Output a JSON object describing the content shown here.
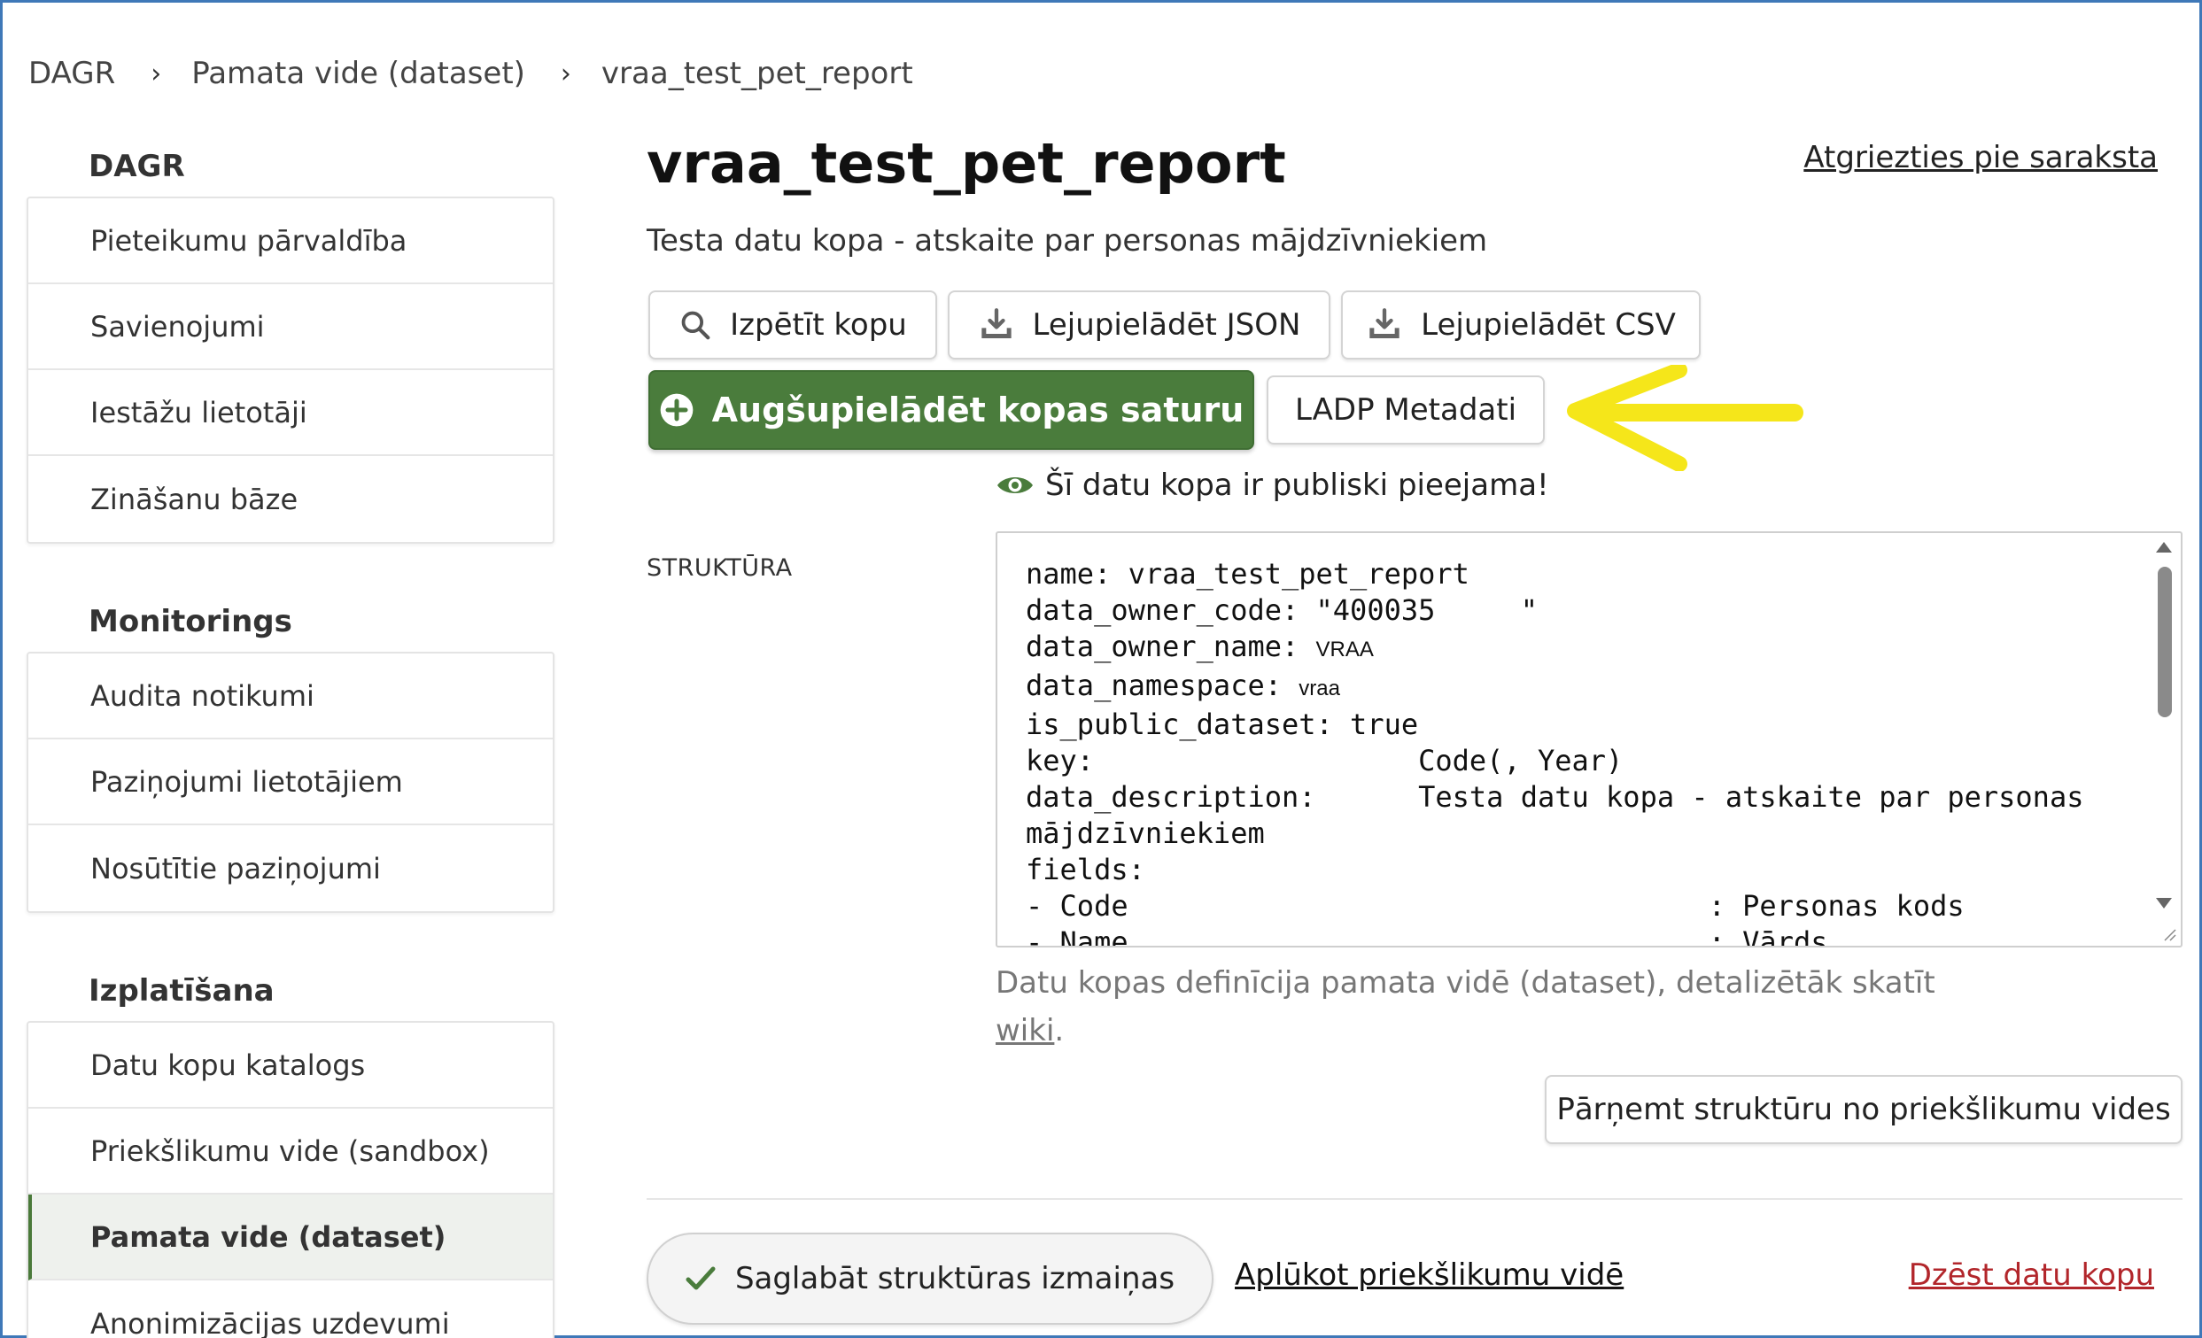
{
  "breadcrumb": {
    "items": [
      "DAGR",
      "Pamata vide (dataset)",
      "vraa_test_pet_report"
    ],
    "separator": "›"
  },
  "sidebar": {
    "sections": [
      {
        "title": "DAGR",
        "items": [
          "Pieteikumu pārvaldība",
          "Savienojumi",
          "Iestāžu lietotāji",
          "Zināšanu bāze"
        ]
      },
      {
        "title": "Monitorings",
        "items": [
          "Audita notikumi",
          "Paziņojumi lietotājiem",
          "Nosūtītie paziņojumi"
        ]
      },
      {
        "title": "Izplatīšana",
        "items": [
          "Datu kopu katalogs",
          "Priekšlikumu vide (sandbox)",
          "Pamata vide (dataset)",
          "Anonimizācijas uzdevumi"
        ]
      }
    ],
    "active_item": "Pamata vide (dataset)"
  },
  "main": {
    "title": "vraa_test_pet_report",
    "back_link": "Atgriezties pie saraksta",
    "subtitle": "Testa datu kopa - atskaite par personas mājdzīvniekiem",
    "buttons": {
      "explore": "Izpētīt kopu",
      "download_json": "Lejupielādēt JSON",
      "download_csv": "Lejupielādēt CSV",
      "upload": "Augšupielādēt kopas saturu",
      "metadata": "LADP Metadati"
    },
    "public_note": "Šī datu kopa ir publiski pieejama!",
    "structure_label": "STRUKTŪRA",
    "code_lines": [
      "name: vraa_test_pet_report",
      "data_owner_code: \"400035     \"",
      "data_owner_name: ",
      "data_namespace: ",
      "is_public_dataset: true",
      "key:                   Code(, Year)",
      "data_description:      Testa datu kopa - atskaite par personas",
      "mājdzīvniekiem",
      "fields:",
      "- Code                                  : Personas kods",
      "- Name                                  : Vārds"
    ],
    "code_small": {
      "owner_name": "VRAA",
      "namespace": "vraa"
    },
    "hint_text": "Datu kopas definīcija pamata vidē (dataset), detalizētāk skatīt",
    "hint_link": "wiki",
    "hint_end": ".",
    "take_structure_button": "Pārņemt struktūru no priekšlikumu vides",
    "save_button": "Saglabāt struktūras izmaiņas",
    "view_sandbox_link": "Aplūkot priekšlikumu vidē",
    "delete_link": "Dzēst datu kopu"
  },
  "colors": {
    "accent_green": "#4a7c3c",
    "delete_red": "#b2262b",
    "annotation_yellow": "#f5e61a",
    "frame_blue": "#3f78b8"
  },
  "icons": [
    "search-icon",
    "download-icon",
    "plus-circle-icon",
    "eye-icon",
    "check-icon",
    "chevron-right-icon"
  ]
}
